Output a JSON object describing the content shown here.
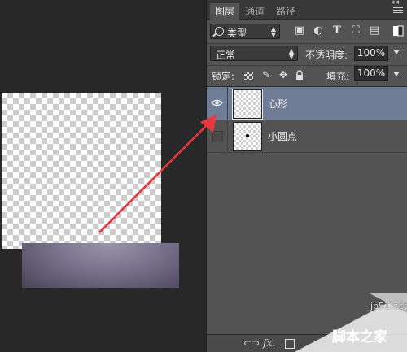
{
  "panel": {
    "tabs": [
      {
        "label": "图层",
        "active": true
      },
      {
        "label": "通道",
        "active": false
      },
      {
        "label": "路径",
        "active": false
      }
    ],
    "filter": {
      "label": "类型"
    },
    "blend_mode": "正常",
    "opacity": {
      "label": "不透明度:",
      "value": "100%"
    },
    "lock": {
      "label": "锁定:"
    },
    "fill": {
      "label": "填充:",
      "value": "100%"
    },
    "layers": [
      {
        "name": "心形",
        "visible": true,
        "selected": true
      },
      {
        "name": "小圆点",
        "visible": false,
        "selected": false
      }
    ]
  },
  "footer": {
    "fx_label": "fx."
  },
  "watermark": {
    "site": "jb51.net",
    "brand": "脚本之家"
  },
  "colors": {
    "panel_bg": "#535353",
    "selected_layer": "#6f7d97",
    "arrow": "#e8383d",
    "canvas_bg": "#282828"
  }
}
